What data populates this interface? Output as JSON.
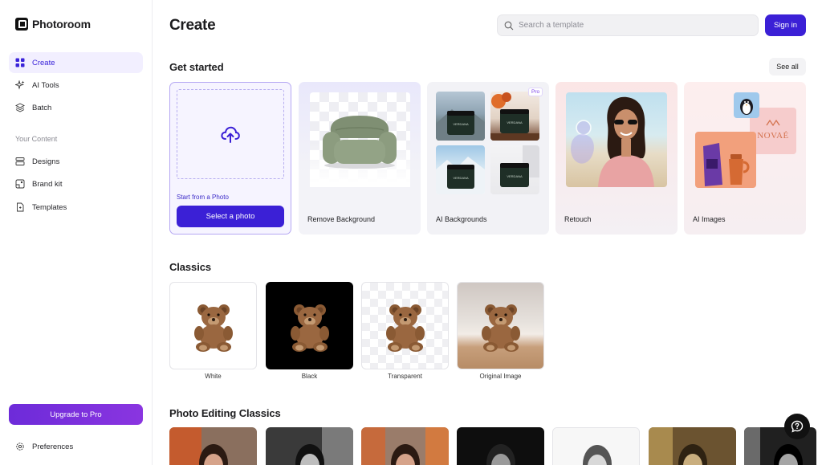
{
  "brand": {
    "name": "Photoroom"
  },
  "sidebar": {
    "items": [
      {
        "label": "Create",
        "icon": "grid-icon",
        "active": true
      },
      {
        "label": "AI Tools",
        "icon": "sparkles-icon",
        "active": false
      },
      {
        "label": "Batch",
        "icon": "layers-icon",
        "active": false
      }
    ],
    "content_label": "Your Content",
    "content_items": [
      {
        "label": "Designs",
        "icon": "designs-icon"
      },
      {
        "label": "Brand kit",
        "icon": "brand-kit-icon"
      },
      {
        "label": "Templates",
        "icon": "templates-icon"
      }
    ],
    "upgrade_label": "Upgrade to Pro",
    "preferences_label": "Preferences"
  },
  "header": {
    "title": "Create",
    "search_placeholder": "Search a template",
    "signin_label": "Sign in"
  },
  "get_started": {
    "title": "Get started",
    "see_all": "See all",
    "upload": {
      "caption": "Start from a Photo",
      "button": "Select a photo"
    },
    "cards": [
      {
        "label": "Remove Background"
      },
      {
        "label": "AI Backgrounds",
        "badge": "Pro",
        "product_text": "VERDANA"
      },
      {
        "label": "Retouch"
      },
      {
        "label": "AI Images",
        "brand_text": "NOVAÉ"
      }
    ]
  },
  "classics": {
    "title": "Classics",
    "items": [
      {
        "label": "White"
      },
      {
        "label": "Black"
      },
      {
        "label": "Transparent"
      },
      {
        "label": "Original Image"
      }
    ]
  },
  "photo_editing": {
    "title": "Photo Editing Classics",
    "count": 7
  },
  "colors": {
    "accent": "#3b20d6",
    "upgrade_start": "#6d2bd9",
    "upgrade_end": "#8a35e0",
    "active_bg": "#f2efff"
  }
}
